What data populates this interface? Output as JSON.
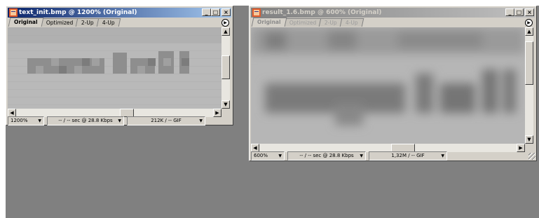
{
  "windows": [
    {
      "title": "text_init.bmp @ 1200% (Original)",
      "active": true,
      "tabs": [
        "Original",
        "Optimized",
        "2-Up",
        "4-Up"
      ],
      "selected_tab": "Original",
      "controls": {
        "minimize": "_",
        "maximize": "□",
        "close": "×"
      },
      "status": {
        "zoom": "1200%",
        "download": "-- / -- sec @ 28.8 Kbps",
        "size": "212K / -- GIF"
      }
    },
    {
      "title": "result_1.6.bmp @ 600% (Original)",
      "active": false,
      "tabs": [
        "Original",
        "Optimized",
        "2-Up",
        "4-Up"
      ],
      "selected_tab": "Original",
      "controls": {
        "minimize": "_",
        "maximize": "□",
        "close": "×"
      },
      "status": {
        "zoom": "600%",
        "download": "-- / -- sec @ 28.8 Kbps",
        "size": "1,32M / -- GIF"
      }
    }
  ],
  "icons": {
    "app": "photoshop-document-icon",
    "dropdown": "triangle-down-icon",
    "preview": "play-circle-icon",
    "scroll_up": "arrow-up-icon",
    "scroll_down": "arrow-down-icon",
    "scroll_left": "arrow-left-icon",
    "scroll_right": "arrow-right-icon"
  },
  "colors": {
    "workspace": "#808080",
    "active_title": "#0a246a",
    "inactive_title": "#808080",
    "chrome": "#d4d0c8"
  }
}
